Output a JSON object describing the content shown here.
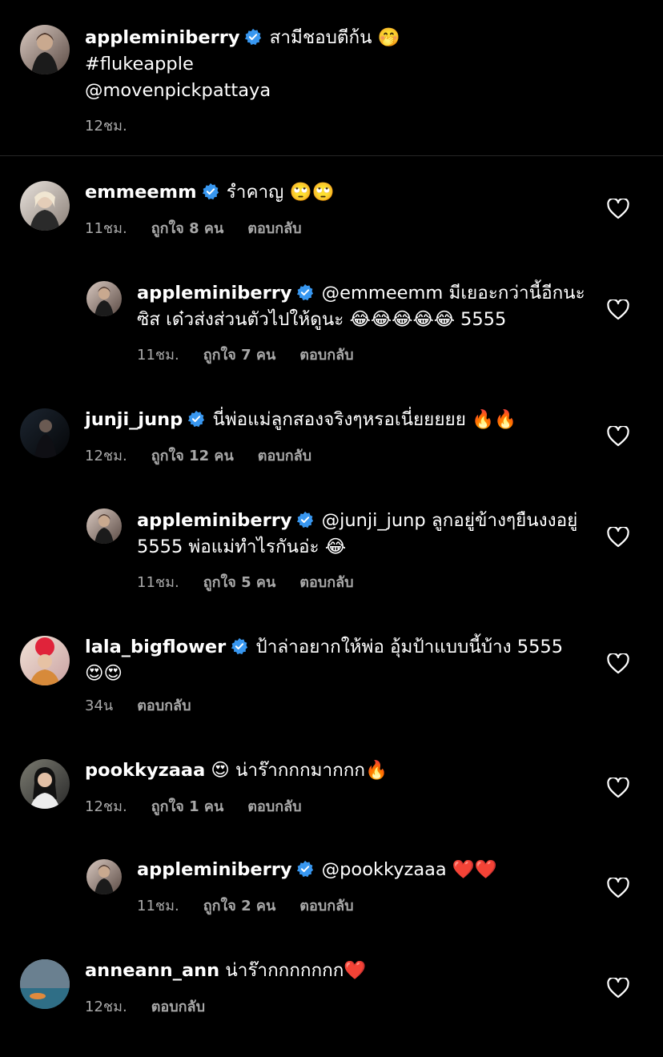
{
  "caption": {
    "username": "appleminiberry",
    "text": "สามีชอบตีก้น 🤭",
    "hashtag": "#flukeapple",
    "mention": "@movenpickpattaya",
    "time": "12ชม."
  },
  "comments": [
    {
      "username": "emmeemm",
      "text": "รำคาญ 🙄🙄",
      "time": "11ชม.",
      "likes": "ถูกใจ 8 คน",
      "reply": "ตอบกลับ"
    },
    {
      "username": "appleminiberry",
      "text1": "@emmeemm มีเยอะกว่านี้อีกนะ",
      "text2": "ซิส เด๋วส่งส่วนตัวไปให้ดูนะ 😂😂😂😂😂 5555",
      "time": "11ชม.",
      "likes": "ถูกใจ 7 คน",
      "reply": "ตอบกลับ"
    },
    {
      "username": "junji_junp",
      "text": "นี่พ่อแม่ลูกสองจริงๆหรอเนี่ยยยยย 🔥🔥",
      "time": "12ชม.",
      "likes": "ถูกใจ 12 คน",
      "reply": "ตอบกลับ"
    },
    {
      "username": "appleminiberry",
      "text1": "@junji_junp ลูกอยู่ข้างๆยืนงงอยู่",
      "text2": "5555 พ่อแม่ทำไรกันอ่ะ 😂",
      "time": "11ชม.",
      "likes": "ถูกใจ 5 คน",
      "reply": "ตอบกลับ"
    },
    {
      "username": "lala_bigflower",
      "text1": "ป้าล่าอยากให้พ่อ อุ้มป้าแบบนี้บ้าง 5555",
      "text2": "😍😍",
      "time": "34น",
      "reply": "ตอบกลับ"
    },
    {
      "username": "pookkyzaaa",
      "text": "😍 น่าร๊ากกกมากกก🔥",
      "time": "12ชม.",
      "likes": "ถูกใจ 1 คน",
      "reply": "ตอบกลับ"
    },
    {
      "username": "appleminiberry",
      "text": "@pookkyzaaa ❤️❤️",
      "time": "11ชม.",
      "likes": "ถูกใจ 2 คน",
      "reply": "ตอบกลับ"
    },
    {
      "username": "anneann_ann",
      "text": "น่าร๊ากกกกกกก❤️",
      "time": "12ชม.",
      "reply": "ตอบกลับ"
    }
  ],
  "colors": {
    "background": "#000000",
    "verified": "#3897f0",
    "secondary_text": "#a8a8a8",
    "divider": "#262626"
  }
}
